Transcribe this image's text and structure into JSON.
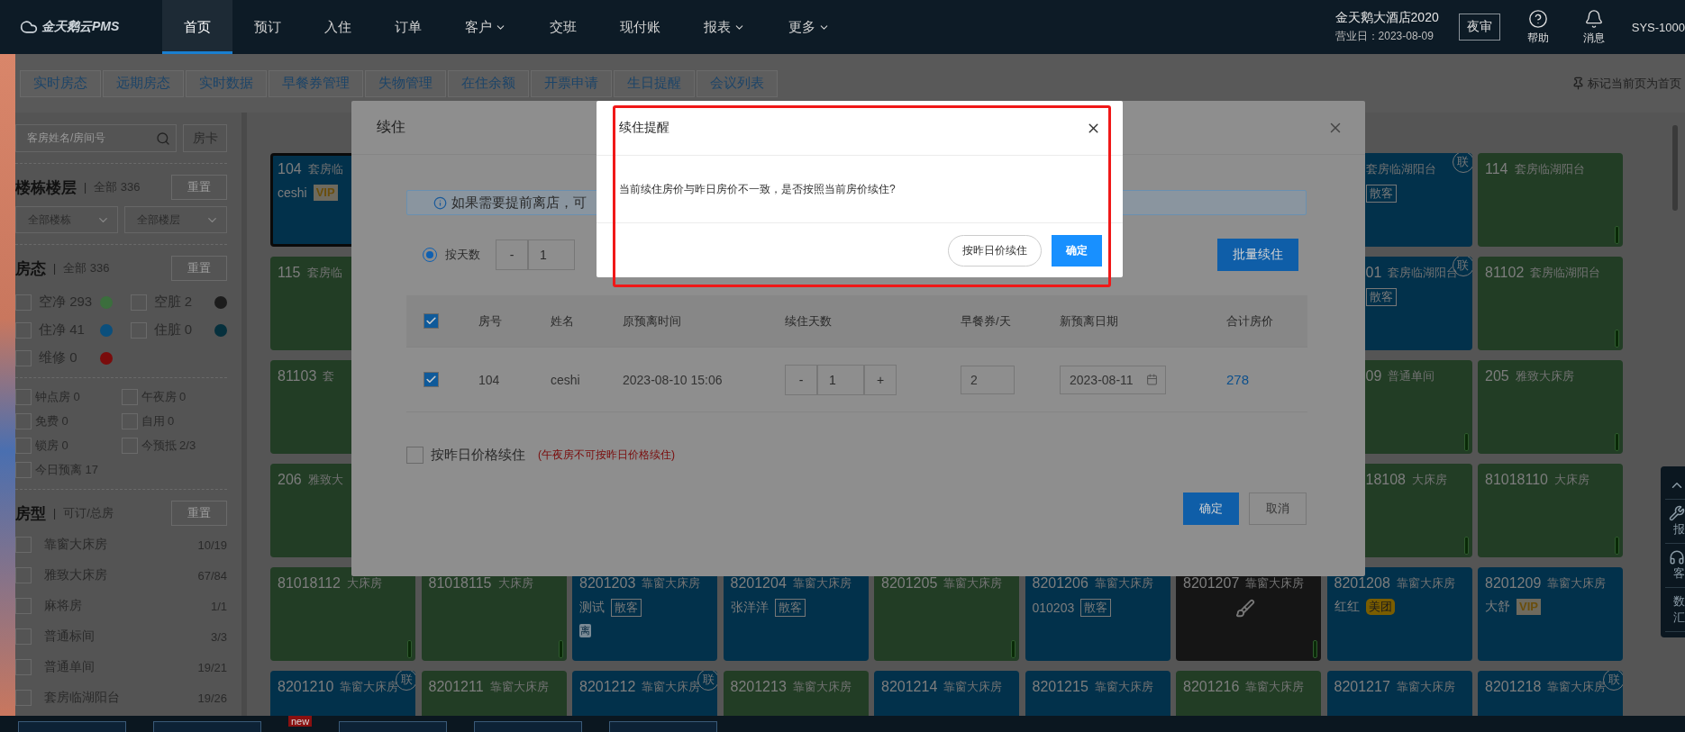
{
  "nav": {
    "logo": "金天鹅云PMS",
    "items": [
      {
        "label": "首页",
        "selected": true,
        "dropdown": false
      },
      {
        "label": "预订",
        "selected": false,
        "dropdown": false
      },
      {
        "label": "入住",
        "selected": false,
        "dropdown": false
      },
      {
        "label": "订单",
        "selected": false,
        "dropdown": false
      },
      {
        "label": "客户",
        "selected": false,
        "dropdown": true
      },
      {
        "label": "交班",
        "selected": false,
        "dropdown": false
      },
      {
        "label": "现付账",
        "selected": false,
        "dropdown": false
      },
      {
        "label": "报表",
        "selected": false,
        "dropdown": true
      },
      {
        "label": "更多",
        "selected": false,
        "dropdown": true
      }
    ],
    "hotel": "金天鹅大酒店2020",
    "business_day": "营业日：2023-08-09",
    "night_audit": "夜审",
    "tools": [
      {
        "kind": "help",
        "label": "帮助"
      },
      {
        "kind": "bell",
        "label": "消息"
      }
    ],
    "user": "SYS-1000"
  },
  "tabs": {
    "items": [
      "实时房态",
      "远期房态",
      "实时数据",
      "早餐券管理",
      "失物管理",
      "在住余额",
      "开票申请",
      "生日提醒",
      "会议列表"
    ],
    "pin_label": "标记当前页为首页"
  },
  "sidebar": {
    "search": {
      "placeholder": "客房姓名/房间号"
    },
    "card_button": "房卡",
    "building": {
      "title": "楼栋楼层",
      "separator": "|",
      "summary": "全部 336",
      "reset": "重置",
      "selects": [
        "全部楼栋",
        "全部楼层"
      ]
    },
    "status": {
      "title": "房态",
      "separator": "|",
      "summary": "全部 336",
      "reset": "重置",
      "items": [
        {
          "label": "空净 293",
          "checked": false,
          "color": "#3b6e3d"
        },
        {
          "label": "空脏 2",
          "checked": false,
          "color": "#1c1c1c"
        },
        {
          "label": "住净 41",
          "checked": false,
          "color": "#0b4f7c"
        },
        {
          "label": "住脏 0",
          "checked": false,
          "color": "#06303d"
        },
        {
          "label": "维修 0",
          "checked": false,
          "color": "#7a0c0c"
        }
      ]
    },
    "flags": [
      {
        "label": "钟点房 0",
        "checked": false
      },
      {
        "label": "午夜房 0",
        "checked": false
      },
      {
        "label": "免费 0",
        "checked": false
      },
      {
        "label": "自用 0",
        "checked": false
      },
      {
        "label": "锁房 0",
        "checked": false
      },
      {
        "label": "今预抵 2/3",
        "checked": false
      },
      {
        "label": "今日预离 17",
        "checked": false
      }
    ],
    "room_types": {
      "title": "房型",
      "separator": "|",
      "summary": "可订/总房",
      "reset": "重置",
      "items": [
        {
          "label": "靠窗大床房",
          "count": "10/19",
          "checked": false
        },
        {
          "label": "雅致大床房",
          "count": "67/84",
          "checked": false
        },
        {
          "label": "麻将房",
          "count": "1/1",
          "checked": false
        },
        {
          "label": "普通标间",
          "count": "3/3",
          "checked": false
        },
        {
          "label": "普通单间",
          "count": "19/21",
          "checked": false
        },
        {
          "label": "套房临湖阳台",
          "count": "19/26",
          "checked": false
        }
      ]
    }
  },
  "rooms": [
    {
      "tiles": [
        {
          "number": "104",
          "type": "套房临",
          "guest": "ceshi",
          "tag": {
            "text": "VIP",
            "kind": "vip"
          },
          "kind": "occupied",
          "selected": true
        },
        {
          "type": "套房临湖阳台",
          "tag": {
            "text": "散客",
            "kind": "outline"
          },
          "kind": "occupied",
          "selected": false,
          "badge": "联"
        },
        {
          "number": "114",
          "type": "套房临湖阳台",
          "kind": "vacant",
          "selected": false
        }
      ]
    },
    {
      "tiles": [
        {
          "number": "115",
          "type": "套房临",
          "kind": "vacant",
          "selected": false
        },
        {
          "number": "01",
          "type": "套房临湖阳台",
          "tag": {
            "text": "散客",
            "kind": "outline"
          },
          "kind": "occupied",
          "selected": false,
          "badge": "联"
        },
        {
          "number": "81102",
          "type": "套房临湖阳台",
          "kind": "vacant",
          "selected": false
        }
      ]
    },
    {
      "tiles": [
        {
          "number": "81103",
          "type": "套",
          "kind": "vacant",
          "selected": false
        },
        {
          "number": "09",
          "type": "普通单间",
          "kind": "vacant",
          "selected": false
        },
        {
          "number": "205",
          "type": "雅致大床房",
          "kind": "vacant",
          "selected": false
        }
      ]
    },
    {
      "tiles": [
        {
          "number": "206",
          "type": "雅致大",
          "kind": "vacant",
          "selected": false
        },
        {
          "number": "18108",
          "type": "大床房",
          "kind": "vacant",
          "selected": false
        },
        {
          "number": "81018110",
          "type": "大床房",
          "kind": "vacant",
          "selected": false
        }
      ]
    },
    {
      "tiles": [
        {
          "number": "81018112",
          "type": "大床房",
          "kind": "vacant",
          "selected": false
        },
        {
          "number": "81018115",
          "type": "大床房",
          "kind": "vacant",
          "selected": false
        },
        {
          "number": "8201203",
          "type": "靠窗大床房",
          "guest": "测试",
          "tag": {
            "text": "散客",
            "kind": "outline"
          },
          "mark": "离",
          "kind": "occupied",
          "selected": false
        },
        {
          "number": "8201204",
          "type": "靠窗大床房",
          "guest": "张洋洋",
          "tag": {
            "text": "散客",
            "kind": "outline"
          },
          "kind": "occupied",
          "selected": false
        },
        {
          "number": "8201205",
          "type": "靠窗大床房",
          "kind": "vacant",
          "selected": false
        },
        {
          "number": "8201206",
          "type": "靠窗大床房",
          "guest": "010203",
          "tag": {
            "text": "散客",
            "kind": "outline"
          },
          "kind": "occupied",
          "selected": false
        },
        {
          "number": "8201207",
          "type": "靠窗大床房",
          "kind": "dirty",
          "selected": false
        },
        {
          "number": "8201208",
          "type": "靠窗大床房",
          "guest": "红红",
          "tag": {
            "text": "美团",
            "kind": "meituan"
          },
          "kind": "occupied",
          "selected": false
        },
        {
          "number": "8201209",
          "type": "靠窗大床房",
          "guest": "大舒",
          "tag": {
            "text": "VIP",
            "kind": "vip"
          },
          "kind": "occupied",
          "selected": false
        }
      ]
    },
    {
      "tiles": [
        {
          "number": "8201210",
          "type": "靠窗大床房",
          "kind": "occupied",
          "selected": false,
          "badge": "联"
        },
        {
          "number": "8201211",
          "type": "靠窗大床房",
          "kind": "vacant",
          "selected": false
        },
        {
          "number": "8201212",
          "type": "靠窗大床房",
          "kind": "occupied",
          "selected": false,
          "badge": "联"
        },
        {
          "number": "8201213",
          "type": "靠窗大床房",
          "kind": "vacant",
          "selected": false
        },
        {
          "number": "8201214",
          "type": "靠窗大床房",
          "kind": "occupied",
          "selected": false
        },
        {
          "number": "8201215",
          "type": "靠窗大床房",
          "kind": "occupied",
          "selected": false
        },
        {
          "number": "8201216",
          "type": "靠窗大床房",
          "kind": "vacant",
          "selected": false
        },
        {
          "number": "8201217",
          "type": "靠窗大床房",
          "kind": "occupied",
          "selected": false
        },
        {
          "number": "8201218",
          "type": "靠窗大床房",
          "kind": "occupied",
          "selected": false,
          "badge": "联"
        }
      ]
    }
  ],
  "side_tools": [
    {
      "kind": "up"
    },
    {
      "kind": "wrench",
      "lines": [
        "报"
      ]
    },
    {
      "kind": "headset",
      "lines": [
        "客"
      ]
    },
    {
      "kind": "text",
      "lines": [
        "数",
        "汇"
      ]
    }
  ],
  "bottom_bar": {
    "badge": "new"
  },
  "extend_dialog": {
    "title": "续住",
    "notice": "如果需要提前离店，可",
    "by_days": {
      "label": "按天数",
      "selected": true,
      "minus": "-",
      "value": "1"
    },
    "batch_button": "批量续住",
    "columns": [
      "房号",
      "姓名",
      "原预离时间",
      "续住天数",
      "早餐券/天",
      "新预离日期",
      "合计房价"
    ],
    "header_checked": true,
    "rows": [
      {
        "checked": true,
        "room": "104",
        "name": "ceshi",
        "departure": "2023-08-10 15:06",
        "minus": "-",
        "days": "1",
        "plus": "+",
        "breakfast": "2",
        "new_date": "2023-08-11",
        "total": "278"
      }
    ],
    "yesterday_price": {
      "label": "按昨日价格续住",
      "checked": false,
      "note": "(午夜房不可按昨日价格续住)"
    },
    "buttons": [
      {
        "label": "确定",
        "kind": "primary"
      },
      {
        "label": "取消",
        "kind": "default"
      }
    ]
  },
  "reminder_dialog": {
    "title": "续住提醒",
    "message": "当前续住房价与昨日房价不一致，是否按照当前房价续住?",
    "buttons": [
      {
        "label": "按昨日价续住",
        "kind": "pill"
      },
      {
        "label": "确定",
        "kind": "primary"
      }
    ],
    "highlighted": true
  }
}
